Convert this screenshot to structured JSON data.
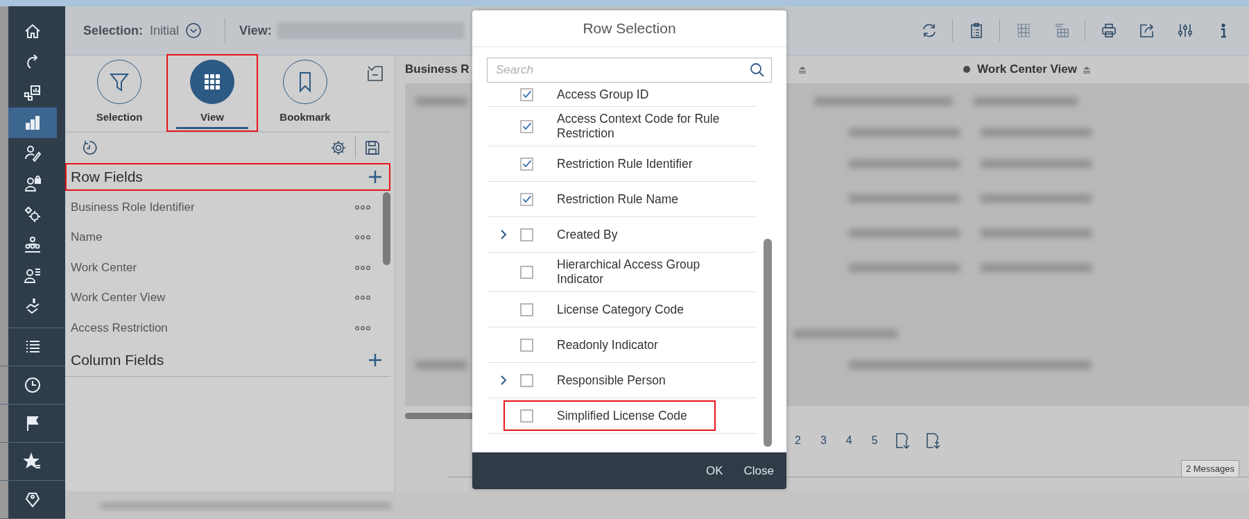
{
  "top_bar": {
    "selection_label": "Selection:",
    "selection_value": "Initial",
    "view_label": "View:"
  },
  "nav_items": [
    {
      "selected": false
    },
    {
      "selected": false
    },
    {
      "selected": false
    },
    {
      "selected": true
    },
    {
      "selected": false
    },
    {
      "selected": false
    },
    {
      "selected": false
    },
    {
      "selected": false
    },
    {
      "selected": false
    },
    {
      "selected": false
    }
  ],
  "panel_tabs": [
    {
      "label": "Selection",
      "selected": false,
      "highlighted": false
    },
    {
      "label": "View",
      "selected": true,
      "highlighted": true
    },
    {
      "label": "Bookmark",
      "selected": false,
      "highlighted": false
    }
  ],
  "row_fields": {
    "title": "Row Fields",
    "highlighted": true,
    "items": [
      "Business Role Identifier",
      "Name",
      "Work Center",
      "Work Center View",
      "Access Restriction"
    ]
  },
  "column_fields": {
    "title": "Column Fields"
  },
  "table": {
    "columns": [
      "Business R",
      "Work Center View"
    ]
  },
  "dialog": {
    "title": "Row Selection",
    "search": {
      "placeholder": "Search"
    },
    "items": [
      {
        "label": "Access Group ID",
        "checked": true,
        "expandable": false,
        "highlighted": false
      },
      {
        "label": "Access Context Code for Rule Restriction",
        "checked": true,
        "expandable": false,
        "highlighted": false
      },
      {
        "label": "Restriction Rule Identifier",
        "checked": true,
        "expandable": false,
        "highlighted": false
      },
      {
        "label": "Restriction Rule Name",
        "checked": true,
        "expandable": false,
        "highlighted": false
      },
      {
        "label": "Created By",
        "checked": false,
        "expandable": true,
        "highlighted": false
      },
      {
        "label": "Hierarchical Access Group Indicator",
        "checked": false,
        "expandable": false,
        "highlighted": false
      },
      {
        "label": "License Category Code",
        "checked": false,
        "expandable": false,
        "highlighted": false
      },
      {
        "label": "Readonly Indicator",
        "checked": false,
        "expandable": false,
        "highlighted": false
      },
      {
        "label": "Responsible Person",
        "checked": false,
        "expandable": true,
        "highlighted": false
      },
      {
        "label": "Simplified License Code",
        "checked": false,
        "expandable": false,
        "highlighted": true
      }
    ],
    "buttons": [
      "OK",
      "Close"
    ]
  },
  "pagination": {
    "pages": [
      "2",
      "3",
      "4",
      "5"
    ]
  },
  "messages": "2 Messages"
}
